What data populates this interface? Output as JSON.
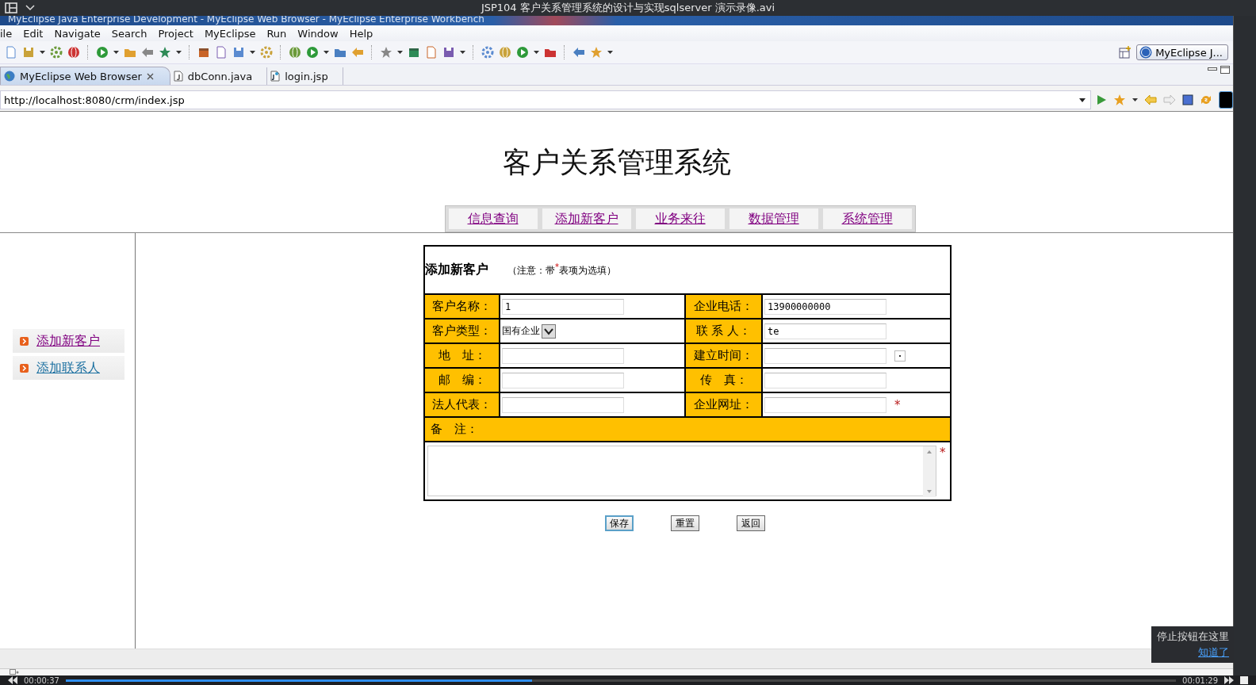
{
  "player": {
    "title": "JSP104 客户关系管理系统的设计与实现sqlserver 演示录像.avi",
    "elapsed": "00:00:37",
    "duration": "00:01:29",
    "level": 0.42,
    "tip": {
      "text": "停止按钮在这里",
      "link": "知道了"
    }
  },
  "ide": {
    "title": "MyEclipse Java Enterprise Development - MyEclipse Web Browser - MyEclipse Enterprise Workbench",
    "menu": [
      "ile",
      "Edit",
      "Navigate",
      "Search",
      "Project",
      "MyEclipse",
      "Run",
      "Window",
      "Help"
    ],
    "perspective": "MyEclipse J...",
    "tabs": [
      {
        "label": "MyEclipse Web Browser",
        "selected": true,
        "kind": "browser"
      },
      {
        "label": "dbConn.java",
        "selected": false,
        "kind": "java"
      },
      {
        "label": "login.jsp",
        "selected": false,
        "kind": "jsp"
      }
    ],
    "url": "http://localhost:8080/crm/index.jsp"
  },
  "page": {
    "title": "客户关系管理系统",
    "nav": [
      "信息查询",
      "添加新客户",
      "业务来往",
      "数据管理",
      "系统管理"
    ],
    "sidebar": [
      {
        "label": "添加新客户",
        "visited": true
      },
      {
        "label": "添加联系人",
        "visited": false
      }
    ],
    "form": {
      "heading": "添加新客户",
      "note": "（注意：带$^{*}$表项为选填）",
      "rows": [
        [
          {
            "label": "客户名称：",
            "kind": "text",
            "value": "1"
          },
          {
            "label": "企业电话：",
            "kind": "text",
            "value": "13900000000"
          }
        ],
        [
          {
            "label": "客户类型：",
            "kind": "select",
            "value": "国有企业"
          },
          {
            "label": "联 系 人：",
            "kind": "text",
            "value": "te"
          }
        ],
        [
          {
            "label": "地　址：",
            "kind": "text"
          },
          {
            "label": "建立时间：",
            "kind": "date"
          }
        ],
        [
          {
            "label": "邮　编：",
            "kind": "text"
          },
          {
            "label": "传　真：",
            "kind": "text"
          }
        ],
        [
          {
            "label": "法人代表：",
            "kind": "text"
          },
          {
            "label": "企业网址：",
            "kind": "optional"
          }
        ]
      ],
      "remark_label": "备　注：",
      "remark_mark": "*",
      "optional_mark": "*",
      "buttons": [
        {
          "label": "保存",
          "focused": true
        },
        {
          "label": "重置",
          "focused": false
        },
        {
          "label": "返回",
          "focused": false
        }
      ]
    }
  }
}
